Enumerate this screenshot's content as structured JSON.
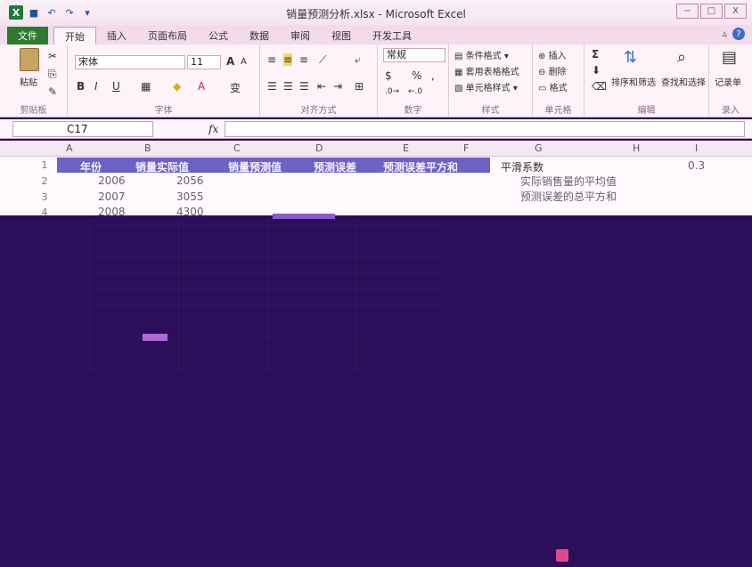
{
  "window": {
    "title": "销量预测分析.xlsx - Microsoft Excel",
    "app_logo": "X",
    "controls": {
      "minimize": "−",
      "maximize": "□",
      "close": "X"
    }
  },
  "qat": {
    "save_icon": "save-icon",
    "undo_icon": "undo-icon",
    "redo_icon": "redo-icon",
    "customize": "▾"
  },
  "tabs": [
    {
      "label": "文件"
    },
    {
      "label": "开始"
    },
    {
      "label": "插入"
    },
    {
      "label": "页面布局"
    },
    {
      "label": "公式"
    },
    {
      "label": "数据"
    },
    {
      "label": "审阅"
    },
    {
      "label": "视图"
    },
    {
      "label": "开发工具"
    }
  ],
  "ribbon": {
    "clipboard": {
      "paste": "粘贴",
      "label": "剪贴板"
    },
    "font": {
      "name": "宋体",
      "size": "11",
      "bold": "B",
      "italic": "I",
      "underline": "U",
      "phonetic": "变",
      "label": "字体"
    },
    "alignment": {
      "label": "对齐方式"
    },
    "number": {
      "format": "常规",
      "percent": "%",
      "comma": ",",
      "label": "数字"
    },
    "styles": {
      "conditional": "条件格式",
      "table": "套用表格格式",
      "cell_styles": "单元格样式",
      "label": "样式"
    },
    "cells": {
      "insert": "插入",
      "delete": "删除",
      "format": "格式",
      "label": "单元格"
    },
    "editing": {
      "sum": "Σ",
      "sort": "排序和筛选",
      "find": "查找和选择",
      "label": "编辑"
    },
    "record": {
      "record": "记录单",
      "label": "录入"
    }
  },
  "formula_bar": {
    "cell_ref": "C17",
    "fx": "fx",
    "value": ""
  },
  "columns": [
    "A",
    "B",
    "C",
    "D",
    "E",
    "F",
    "G",
    "H",
    "I"
  ],
  "rows": [
    "1",
    "2",
    "3",
    "4"
  ],
  "table_headers": [
    "年份",
    "销量实际值",
    "销量预测值",
    "预测误差",
    "预测误差平方和"
  ],
  "side_labels": {
    "smoothing": "平滑系数",
    "smoothing_value": "0.3",
    "mean_actual": "实际销售量的平均值",
    "sse": "预测误差的总平方和"
  },
  "data_rows": [
    {
      "row": "2",
      "year": "2006",
      "actual": "2056"
    },
    {
      "row": "3",
      "year": "2007",
      "actual": "3055"
    },
    {
      "row": "4",
      "year": "2008",
      "actual": "4300"
    }
  ]
}
